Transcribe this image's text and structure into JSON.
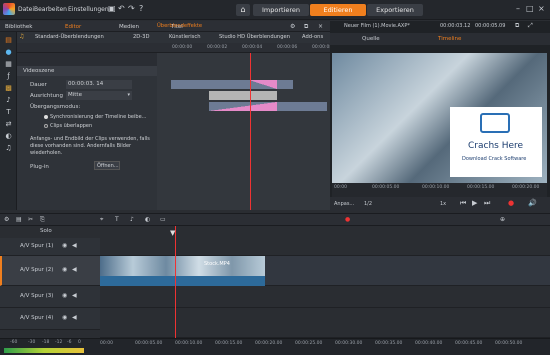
{
  "menu": {
    "file": "Datei",
    "edit": "Bearbeiten",
    "settings": "Einstellungen"
  },
  "modes": {
    "import": "Importieren",
    "edit": "Editieren",
    "export": "Exportieren"
  },
  "tabs": {
    "library": "Bibliothek",
    "editor": "Editor",
    "media": "Medien",
    "title": "Titel"
  },
  "preview_title": "Neuer Film (1).Movie.AXP*",
  "preview_time1": "00:00:03.12",
  "preview_time2": "00:00:05.09",
  "preview_tabs": {
    "source": "Quelle",
    "timeline": "Timeline"
  },
  "effects": {
    "heading": "Überblendeffekte",
    "items": [
      "Standard-Überblendungen",
      "2D-3D",
      "Künstlerisch",
      "Studio HD Überblendungen",
      "Add-ons"
    ]
  },
  "props": {
    "section": "Videoszene",
    "duration_label": "Dauer",
    "duration_value": "00:00:03. 14",
    "align_label": "Ausrichtung",
    "align_value": "Mitte",
    "mode_label": "Übergangsmodus:",
    "opt1": "Synchronisierung der Timeline beibe...",
    "opt2": "Clips überlappen",
    "note": "Anfangs- und Endbild der Clips verwenden, falls diese vorhanden sind. Andernfalls Bilder wiederholen.",
    "plugin_label": "Plug-in",
    "plugin_btn": "Öffnen..."
  },
  "watermark": {
    "title": "Crachs Here",
    "sub": "Download Crack Software"
  },
  "ruler_ticks": [
    "00:00:00",
    "00:00:02",
    "00:00:04",
    "00:00:06",
    "00:00:08"
  ],
  "pv_ticks": [
    "00:00",
    "00:00:05.00",
    "00:00:10.00",
    "00:00:15.00",
    "00:00:20.00"
  ],
  "pv_controls": {
    "aspect": "Anpas...",
    "ratio": "1/2",
    "speed": "1x"
  },
  "tracks": [
    {
      "name": "Solo"
    },
    {
      "name": "A/V Spur (1)"
    },
    {
      "name": "A/V Spur (2)"
    },
    {
      "name": "A/V Spur (3)"
    },
    {
      "name": "A/V Spur (4)"
    }
  ],
  "clip": {
    "label": "Stock.MP4"
  },
  "bottom_ticks": [
    "00:00",
    "00:00:05.00",
    "00:00:10.00",
    "00:00:15.00",
    "00:00:20.00",
    "00:00:25.00",
    "00:00:30.00",
    "00:00:35.00",
    "00:00:40.00",
    "00:00:45.00",
    "00:00:50.00"
  ],
  "meter_ticks": [
    "-60",
    "-30",
    "-18",
    "-12",
    "-6",
    "0"
  ]
}
